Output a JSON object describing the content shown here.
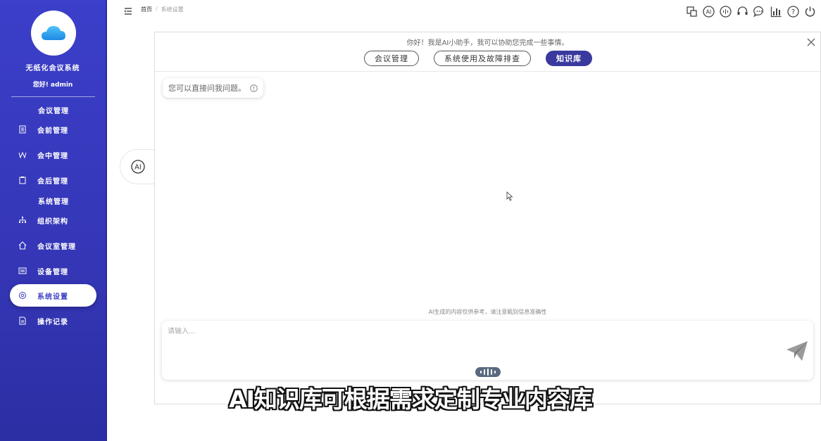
{
  "sidebar": {
    "app_name": "无纸化会议系统",
    "greeting": "您好! admin",
    "groups": [
      {
        "title": "会议管理"
      },
      {
        "title": "系统管理"
      }
    ],
    "items": [
      {
        "label": "会前管理",
        "icon": "document-icon"
      },
      {
        "label": "会中管理",
        "icon": "wave-icon"
      },
      {
        "label": "会后管理",
        "icon": "clipboard-icon"
      },
      {
        "label": "组织架构",
        "icon": "org-chart-icon"
      },
      {
        "label": "会议室管理",
        "icon": "home-icon"
      },
      {
        "label": "设备管理",
        "icon": "device-icon"
      },
      {
        "label": "系统设置",
        "icon": "settings-icon",
        "active": true
      },
      {
        "label": "操作记录",
        "icon": "log-icon"
      }
    ]
  },
  "breadcrumb": {
    "home": "首页",
    "separator": "/",
    "current": "系统设置"
  },
  "ai_tab": {
    "label": "AI"
  },
  "assistant": {
    "welcome": "你好！我是AI小助手，我可以协助您完成一些事情。",
    "chips": [
      {
        "label": "会议管理",
        "active": false
      },
      {
        "label": "系统使用及故障排查",
        "active": false
      },
      {
        "label": "知识库",
        "active": true
      }
    ],
    "bubble": "您可以直接问我问题。",
    "disclaimer": "AI生成的内容仅供参考，请注意甄别信息准确性",
    "input_placeholder": "请输入..."
  },
  "subtitle": "AI知识库可根据需求定制专业内容库",
  "colors": {
    "sidebar": "#3a3cc4",
    "active_chip": "#3a3a9e",
    "white": "#ffffff"
  }
}
